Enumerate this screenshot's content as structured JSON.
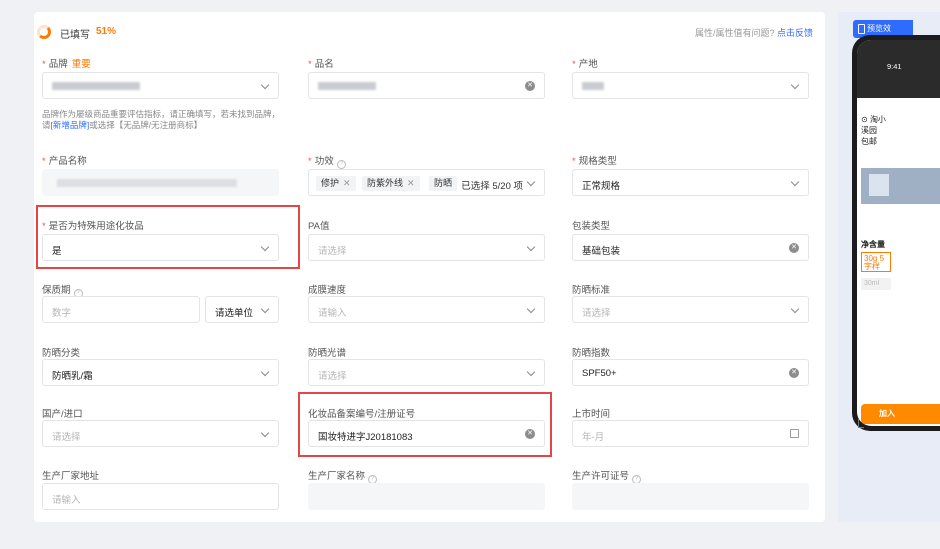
{
  "progress": {
    "label": "已填写",
    "percent_text": "51%",
    "fraction": 0.51
  },
  "feedback": {
    "text": "属性/属性值有问题?",
    "link": "点击反馈"
  },
  "fields": {
    "brand": {
      "label": "品牌",
      "tag": "重要"
    },
    "product_name_short": {
      "label": "品名"
    },
    "origin": {
      "label": "产地"
    },
    "brand_note": {
      "text1": "品牌作为屡级商品重要评估指标，请正确填写，若未找到品牌，请",
      "link": "[新增品牌]",
      "text2": "或选择【无品牌/无注册商标】"
    },
    "product_title": {
      "label": "产品名称"
    },
    "efficacy": {
      "label": "功效",
      "tags": [
        "修护",
        "防紫外线",
        "防晒"
      ],
      "count_text": "已选择 5/20 项"
    },
    "spec_type": {
      "label": "规格类型",
      "value": "正常规格"
    },
    "special_use": {
      "label": "是否为特殊用途化妆品",
      "value": "是"
    },
    "pa": {
      "label": "PA值",
      "placeholder": "请选择"
    },
    "package_type": {
      "label": "包装类型",
      "value": "基础包装"
    },
    "shelf_life": {
      "label": "保质期",
      "placeholder": "数字",
      "unit_value": "请选单位"
    },
    "film_speed": {
      "label": "成膜速度",
      "placeholder": "请输入"
    },
    "sun_standard": {
      "label": "防晒标准",
      "placeholder": "请选择"
    },
    "sun_category": {
      "label": "防晒分类",
      "value": "防晒乳/霜"
    },
    "sun_spectrum": {
      "label": "防晒光谱",
      "placeholder": "请选择"
    },
    "sun_index": {
      "label": "防晒指数",
      "value": "SPF50+"
    },
    "domestic_import": {
      "label": "国产/进口",
      "placeholder": "请选择"
    },
    "registration": {
      "label": "化妆品备案编号/注册证号",
      "value": "国妆特进字J20181083"
    },
    "launch_time": {
      "label": "上市时间",
      "placeholder": "年-月"
    },
    "maker_address": {
      "label": "生产厂家地址",
      "placeholder": "请输入"
    },
    "maker_name": {
      "label": "生产厂家名称"
    },
    "license_no": {
      "label": "生产许可证号"
    }
  },
  "preview": {
    "button": "预览效",
    "time": "9:41",
    "location": "淘小\n溪园\n包邮",
    "net_content": "净含量",
    "option1": "30g 5\n字样",
    "option2": "30ml",
    "buy": "加入"
  }
}
